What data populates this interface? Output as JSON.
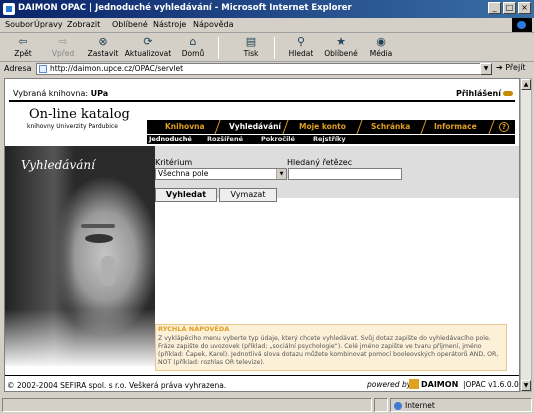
{
  "window": {
    "title": "DAIMON OPAC | Jednoduché vyhledávání - Microsoft Internet Explorer",
    "controls": {
      "minimize": "_",
      "maximize": "□",
      "close": "×"
    }
  },
  "menu": [
    "Soubor",
    "Úpravy",
    "Zobrazit",
    "Oblíbené",
    "Nástroje",
    "Nápověda"
  ],
  "toolbar": {
    "back": "Zpět",
    "forward": "Vpřed",
    "stop": "Zastavit",
    "refresh": "Aktualizovat",
    "home": "Domů",
    "print": "Tisk",
    "search": "Hledat",
    "favorites": "Oblíbené",
    "media": "Média"
  },
  "address": {
    "label": "Adresa",
    "url": "http://daimon.upce.cz/OPAC/servlet",
    "go": "Přejít"
  },
  "page": {
    "library_label": "Vybraná knihovna:",
    "library_value": "UPa",
    "login": "Přihlášení",
    "catalog_title": "On-line katalog",
    "catalog_subtitle": "knihovny Univerzity Pardubice",
    "tabs": [
      "Knihovna",
      "Vyhledávání",
      "Moje konto",
      "Schránka",
      "Informace"
    ],
    "help_icon": "?",
    "subtabs": [
      "Jednoduché",
      "Rozšířené",
      "Pokročilé",
      "Rejstříky"
    ],
    "heading": "Vyhledávání",
    "form": {
      "criterion_label": "Kritérium",
      "criterion_value": "Všechna pole",
      "search_string_label": "Hledaný řetězec",
      "search_string_value": "",
      "search_button": "Vyhledat",
      "clear_button": "Vymazat"
    },
    "quick_help": {
      "title": "RYCHLÁ NÁPOVĚDA",
      "text": "Z vyklápěcího menu vyberte typ údaje, který chcete vyhledávat. Svůj dotaz zapište do vyhledávacího pole. Fráze zapište do uvozovek (příklad: „sociální psychologie“). Celé jméno zapište ve tvaru příjmení, jméno (příklad: Čapek, Karel). Jednotlivá slova dotazu můžete kombinovat pomocí booleovských operátorů AND, OR, NOT (příklad: rozhlas OR televize)."
    },
    "footer": {
      "copyright": "© 2002-2004 SEFIRA spol. s r.o. Veškerá práva vyhrazena.",
      "powered_by": "powered by",
      "brand": "DAIMON",
      "version": "|OPAC v1.6.0.0"
    }
  },
  "status": {
    "zone": "Internet"
  }
}
